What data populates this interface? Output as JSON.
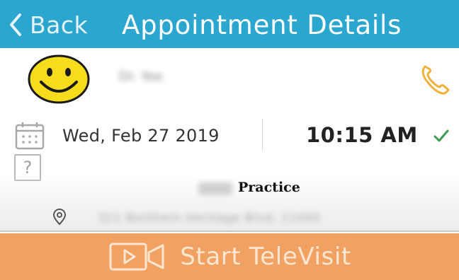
{
  "header": {
    "back_label": "Back",
    "title": "Appointment Details",
    "background": "#2aa6cf"
  },
  "provider": {
    "name": "Dr. Yee",
    "avatar_icon": "smiley-face-icon",
    "phone_icon": "phone-icon",
    "phone_color": "#f0b13a"
  },
  "appointment": {
    "date": "Wed, Feb 27  2019",
    "time": "10:15 AM",
    "status_icon": "checkmark-icon",
    "status_color": "#3f9b53"
  },
  "practice": {
    "name_suffix": "Practice",
    "address": "321 Northern Heritage Blvd, 11000"
  },
  "televisit": {
    "label": "Start TeleVisit",
    "icon": "video-camera-icon",
    "color": "#f1a161"
  }
}
